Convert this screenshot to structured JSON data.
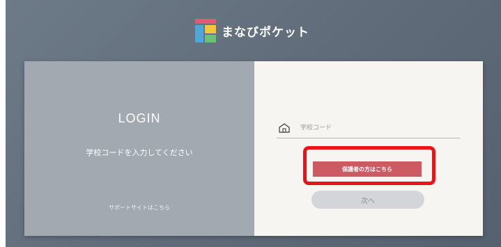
{
  "brand": {
    "name": "まなびポケット"
  },
  "login": {
    "title": "LOGIN",
    "instruction": "学校コードを入力してください",
    "support_link": "サポートサイトはこちら"
  },
  "form": {
    "school_code_placeholder": "学校コード",
    "school_code_value": "",
    "guardian_button": "保護者の方はこちら",
    "next_button": "次へ"
  },
  "icons": {
    "logo": "manabi-pocket-logo-icon",
    "school": "school-building-icon"
  },
  "colors": {
    "background": "#5f6b78",
    "left_panel": "#a3a9b1",
    "right_panel": "#f6f5f1",
    "guardian_button": "#cd5a63",
    "next_button": "#d3d5d8",
    "highlight": "#e8141a"
  }
}
